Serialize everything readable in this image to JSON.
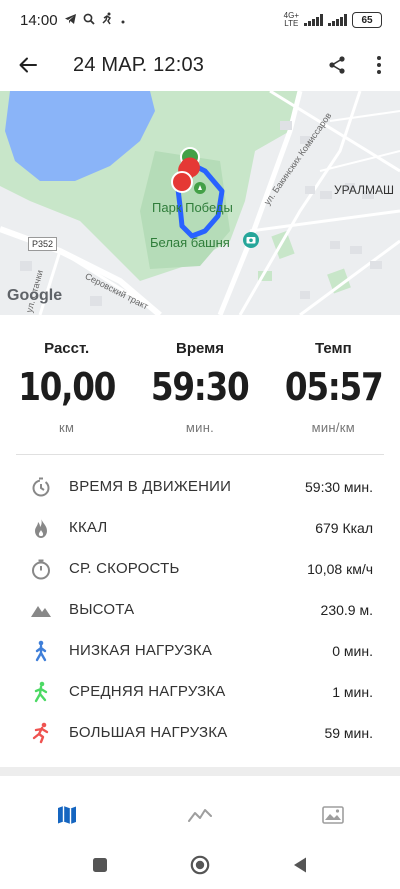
{
  "status_bar": {
    "time": "14:00",
    "network_badge_top": "4G+",
    "network_badge_bottom": "LTE",
    "battery": "65"
  },
  "app_bar": {
    "title": "24 МАР. 12:03",
    "icons": {
      "back": "arrow-left-icon",
      "share": "share-icon",
      "more": "more-vertical-icon"
    }
  },
  "map": {
    "labels": {
      "park": "Парк Победы",
      "tower": "Белая башня",
      "district": "УРАЛМАШ",
      "road_shield": "Р352",
      "street_1": "ул. Бакинских Комиссаров",
      "street_2": "Серовский тракт",
      "street_3": "ул. Стачки"
    },
    "logo": "Google",
    "colors": {
      "water": "#8ab4f8",
      "park": "#c8e6c9",
      "route": "#2962ff",
      "start": "#43a047",
      "finish": "#e53935"
    }
  },
  "stats": [
    {
      "label": "Расст.",
      "value": "10,00",
      "unit": "км"
    },
    {
      "label": "Время",
      "value": "59:30",
      "unit": "мин."
    },
    {
      "label": "Темп",
      "value": "05:57",
      "unit": "мин/км"
    }
  ],
  "details": [
    {
      "icon": "stopwatch-motion-icon",
      "label": "ВРЕМЯ В ДВИЖЕНИИ",
      "value": "59:30 мин.",
      "color": "#888888"
    },
    {
      "icon": "flame-icon",
      "label": "ККАЛ",
      "value": "679 Ккал",
      "color": "#888888"
    },
    {
      "icon": "timer-icon",
      "label": "СР. СКОРОСТЬ",
      "value": "10,08 км/ч",
      "color": "#888888"
    },
    {
      "icon": "mountain-icon",
      "label": "ВЫСОТА",
      "value": "230.9 м.",
      "color": "#888888"
    },
    {
      "icon": "walking-person-icon",
      "label": "НИЗКАЯ НАГРУЗКА",
      "value": "0 мин.",
      "color": "#3f7fd9"
    },
    {
      "icon": "jogging-person-icon",
      "label": "СРЕДНЯЯ НАГРУЗКА",
      "value": "1 мин.",
      "color": "#4cd964"
    },
    {
      "icon": "running-person-icon",
      "label": "БОЛЬШАЯ НАГРУЗКА",
      "value": "59 мин.",
      "color": "#ef5350"
    }
  ],
  "tabs": [
    {
      "icon": "map-icon",
      "active": true
    },
    {
      "icon": "chart-line-icon",
      "active": false
    },
    {
      "icon": "image-icon",
      "active": false
    }
  ],
  "colors": {
    "accent": "#1565c0",
    "inactive": "#9e9e9e"
  }
}
